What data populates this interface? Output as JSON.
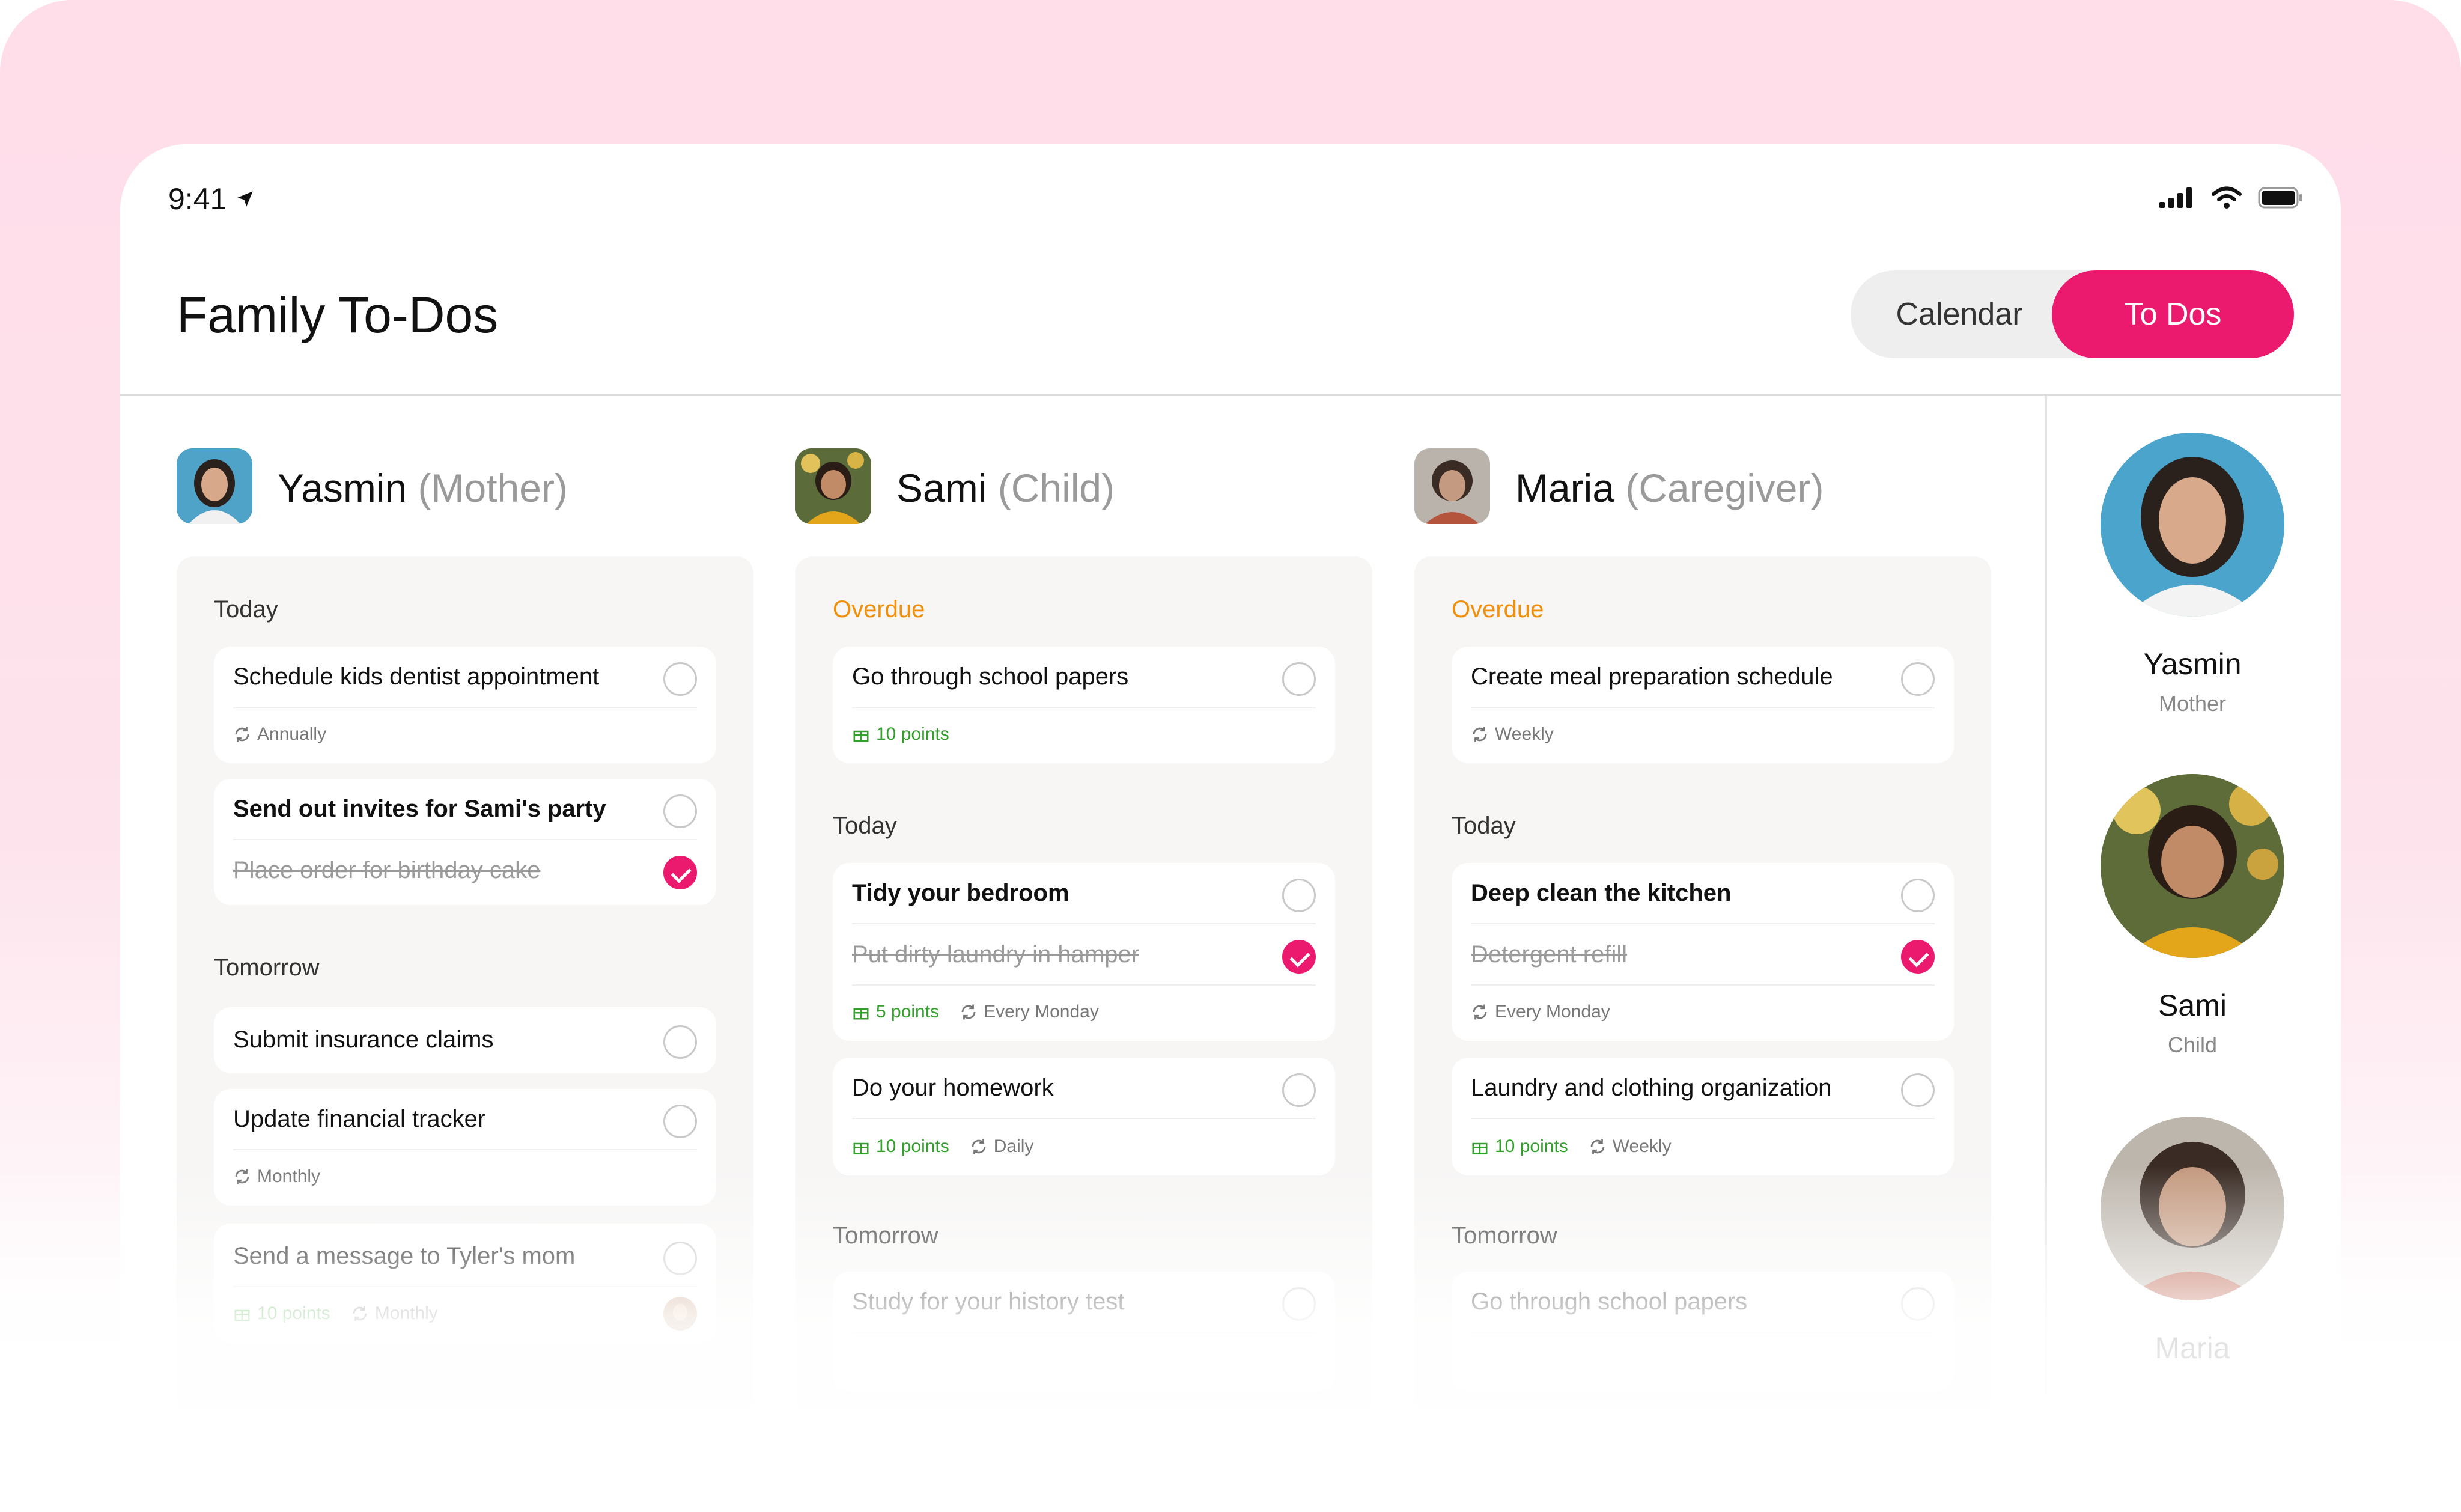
{
  "status": {
    "time": "9:41"
  },
  "header": {
    "title": "Family To-Dos",
    "tabs": [
      "Calendar",
      "To Dos"
    ]
  },
  "columns": [
    {
      "name": "Yasmin",
      "role": "(Mother)",
      "sections": [
        {
          "label": "Today",
          "cards": [
            {
              "rows": [
                {
                  "text": "Schedule kids dentist appointment",
                  "done": false
                }
              ],
              "meta": {
                "repeat": "Annually"
              }
            },
            {
              "rows": [
                {
                  "text": "Send out invites for Sami's party",
                  "done": false
                },
                {
                  "text": "Place order for birthday cake",
                  "done": true
                }
              ]
            }
          ]
        },
        {
          "label": "Tomorrow",
          "cards": [
            {
              "rows": [
                {
                  "text": "Submit insurance claims",
                  "done": false
                }
              ]
            },
            {
              "rows": [
                {
                  "text": "Update financial tracker",
                  "done": false
                }
              ],
              "meta": {
                "repeat": "Monthly"
              }
            },
            {
              "rows": [
                {
                  "text": "Send a message to Tyler's mom",
                  "done": false
                }
              ],
              "meta": {
                "points": "10 points",
                "repeat": "Monthly"
              }
            }
          ]
        }
      ]
    },
    {
      "name": "Sami",
      "role": "(Child)",
      "sections": [
        {
          "label": "Overdue",
          "cards": [
            {
              "rows": [
                {
                  "text": "Go through school papers",
                  "done": false
                }
              ],
              "meta": {
                "points": "10 points"
              }
            }
          ]
        },
        {
          "label": "Today",
          "cards": [
            {
              "rows": [
                {
                  "text": "Tidy your bedroom",
                  "done": false
                },
                {
                  "text": "Put dirty laundry in hamper",
                  "done": true
                }
              ],
              "meta": {
                "points": "5 points",
                "repeat": "Every Monday"
              }
            },
            {
              "rows": [
                {
                  "text": "Do your homework",
                  "done": false
                }
              ],
              "meta": {
                "points": "10 points",
                "repeat": "Daily"
              }
            }
          ]
        },
        {
          "label": "Tomorrow",
          "cards": [
            {
              "rows": [
                {
                  "text": "Study for your history test",
                  "done": false
                }
              ]
            }
          ]
        }
      ]
    },
    {
      "name": "Maria",
      "role": "(Caregiver)",
      "sections": [
        {
          "label": "Overdue",
          "cards": [
            {
              "rows": [
                {
                  "text": "Create meal preparation schedule",
                  "done": false
                }
              ],
              "meta": {
                "repeat": "Weekly"
              }
            }
          ]
        },
        {
          "label": "Today",
          "cards": [
            {
              "rows": [
                {
                  "text": "Deep clean the kitchen",
                  "done": false
                },
                {
                  "text": "Detergent refill",
                  "done": true
                }
              ],
              "meta": {
                "repeat": "Every Monday"
              }
            },
            {
              "rows": [
                {
                  "text": "Laundry and clothing organization",
                  "done": false
                }
              ],
              "meta": {
                "points": "10 points",
                "repeat": "Weekly"
              }
            }
          ]
        },
        {
          "label": "Tomorrow",
          "cards": [
            {
              "rows": [
                {
                  "text": "Go through school papers",
                  "done": false
                }
              ]
            }
          ]
        }
      ]
    }
  ],
  "sidebar": {
    "people": [
      {
        "name": "Yasmin",
        "role": "Mother"
      },
      {
        "name": "Sami",
        "role": "Child"
      },
      {
        "name": "Maria",
        "role": ""
      }
    ]
  },
  "colors": {
    "accent": "#ec1a6e",
    "overdue": "#ef8f0c",
    "points": "#33a02c",
    "background": "#ffdde9"
  }
}
